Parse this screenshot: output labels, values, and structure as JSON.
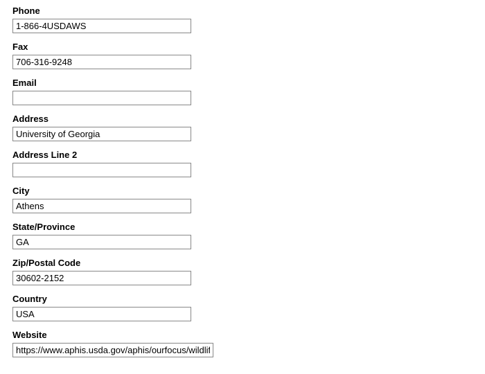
{
  "fields": {
    "phone": {
      "label": "Phone",
      "value": "1-866-4USDAWS"
    },
    "fax": {
      "label": "Fax",
      "value": "706-316-9248"
    },
    "email": {
      "label": "Email",
      "value": ""
    },
    "address": {
      "label": "Address",
      "value": "University of Georgia"
    },
    "address2": {
      "label": "Address Line 2",
      "value": ""
    },
    "city": {
      "label": "City",
      "value": "Athens"
    },
    "state": {
      "label": "State/Province",
      "value": "GA"
    },
    "zip": {
      "label": "Zip/Postal Code",
      "value": "30602-2152"
    },
    "country": {
      "label": "Country",
      "value": "USA"
    },
    "website": {
      "label": "Website",
      "value": "https://www.aphis.usda.gov/aphis/ourfocus/wildlifedamage"
    }
  }
}
